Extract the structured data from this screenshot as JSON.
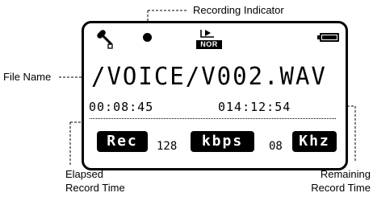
{
  "callouts": {
    "recording_indicator": "Recording Indicator",
    "file_name": "File Name",
    "elapsed": [
      "Elapsed",
      "Record Time"
    ],
    "remaining": [
      "Remaining",
      "Record Time"
    ]
  },
  "display": {
    "mode_badge": "NOR",
    "file_name": "/VOICE/V002.WAV",
    "elapsed_time": "00:08:45",
    "remaining_time": "014:12:54",
    "rec_label": "Rec",
    "bitrate_value": "128",
    "bitrate_unit": "kbps",
    "sample_rate_value": "08",
    "sample_rate_unit": "Khz"
  },
  "icons": [
    "microphone-icon",
    "record-dot-icon",
    "play-mode-icon",
    "battery-icon"
  ]
}
